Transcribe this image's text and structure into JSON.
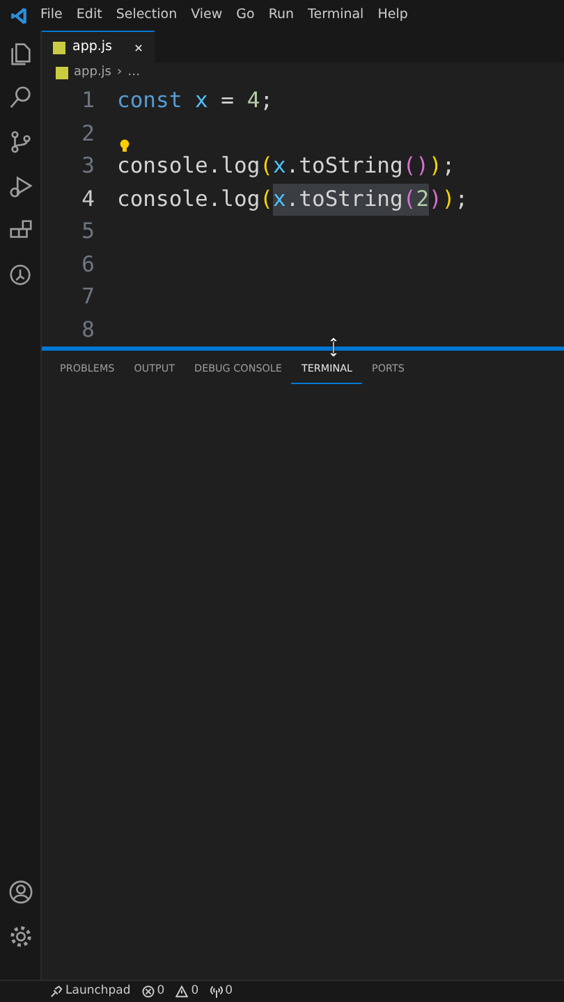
{
  "menu": [
    "File",
    "Edit",
    "Selection",
    "View",
    "Go",
    "Run",
    "Terminal",
    "Help"
  ],
  "activity_bar": [
    {
      "kind": "explorer"
    },
    {
      "kind": "search"
    },
    {
      "kind": "source-control"
    },
    {
      "kind": "run"
    },
    {
      "kind": "extensions"
    },
    {
      "kind": "remote"
    }
  ],
  "tabs": [
    {
      "label": "app.js",
      "selected": true
    }
  ],
  "breadcrumb": {
    "file": "app.js",
    "separator": "›",
    "rest": "…"
  },
  "editor": {
    "lines": [
      {
        "number": "1",
        "current": false,
        "lightbulb": false,
        "tokens": [
          {
            "text": "const ",
            "kind": "keyword",
            "selected": false
          },
          {
            "text": "x",
            "kind": "variable",
            "selected": false
          },
          {
            "text": " = ",
            "kind": "plain",
            "selected": false
          },
          {
            "text": "4",
            "kind": "number",
            "selected": false
          },
          {
            "text": ";",
            "kind": "plain",
            "selected": false
          }
        ]
      },
      {
        "number": "2",
        "current": false,
        "lightbulb": false
      },
      {
        "number": "3",
        "current": false,
        "lightbulb": true,
        "tokens": [
          {
            "text": "console",
            "kind": "plain",
            "selected": false
          },
          {
            "text": ".log",
            "kind": "plain",
            "selected": false
          },
          {
            "text": "(",
            "kind": "bracket1",
            "selected": false
          },
          {
            "text": "x",
            "kind": "variable",
            "selected": false
          },
          {
            "text": ".toString",
            "kind": "plain",
            "selected": false
          },
          {
            "text": "()",
            "kind": "bracket2",
            "selected": false
          },
          {
            "text": ")",
            "kind": "bracket1",
            "selected": false
          },
          {
            "text": ";",
            "kind": "plain",
            "selected": false
          }
        ]
      },
      {
        "number": "4",
        "current": true,
        "lightbulb": false,
        "tokens": [
          {
            "text": "console",
            "kind": "plain",
            "selected": false
          },
          {
            "text": ".log",
            "kind": "plain",
            "selected": false
          },
          {
            "text": "(",
            "kind": "bracket1",
            "selected": false
          },
          {
            "text": "x",
            "kind": "variable",
            "selected": true
          },
          {
            "text": ".toString",
            "kind": "plain",
            "selected": true
          },
          {
            "text": "(",
            "kind": "bracket2",
            "selected": true
          },
          {
            "text": "2",
            "kind": "number",
            "selected": true
          },
          {
            "text": ")",
            "kind": "bracket2",
            "selected": false
          },
          {
            "text": ")",
            "kind": "bracket1",
            "selected": false
          },
          {
            "text": ";",
            "kind": "plain",
            "selected": false
          }
        ]
      },
      {
        "number": "5",
        "current": false,
        "lightbulb": false
      },
      {
        "number": "6",
        "current": false,
        "lightbulb": false
      },
      {
        "number": "7",
        "current": false,
        "lightbulb": false
      },
      {
        "number": "8",
        "current": false,
        "lightbulb": false
      }
    ]
  },
  "panel_tabs": [
    {
      "label": "PROBLEMS",
      "selected": false
    },
    {
      "label": "OUTPUT",
      "selected": false
    },
    {
      "label": "DEBUG CONSOLE",
      "selected": false
    },
    {
      "label": "TERMINAL",
      "selected": true
    },
    {
      "label": "PORTS",
      "selected": false
    }
  ],
  "status_bar": {
    "launchpad": "Launchpad",
    "errors": "0",
    "warnings": "0",
    "ports": "0"
  }
}
